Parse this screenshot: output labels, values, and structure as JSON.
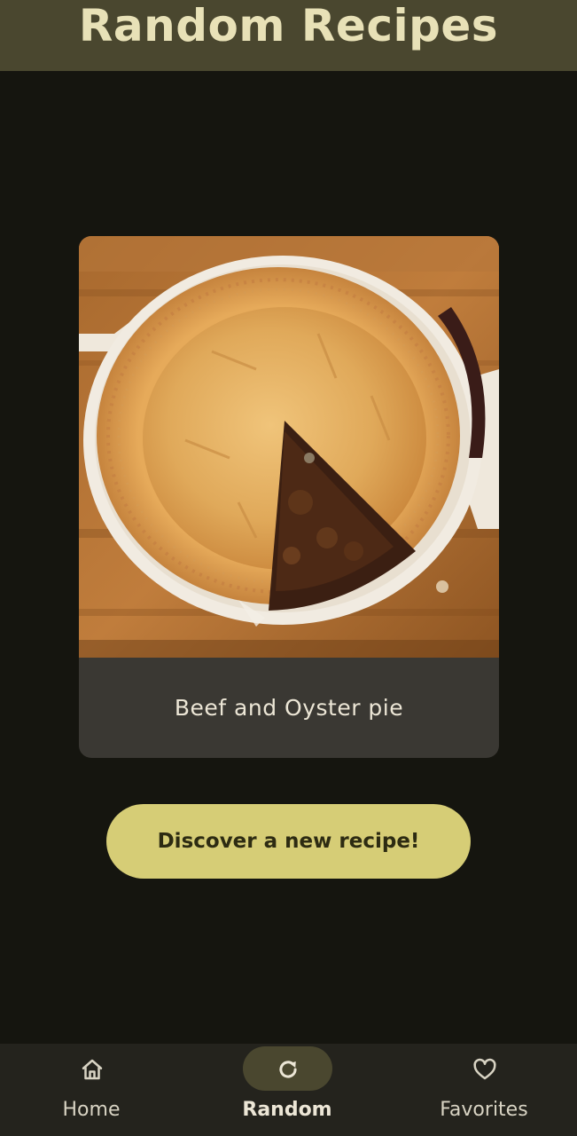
{
  "header": {
    "title": "Random Recipes"
  },
  "recipe": {
    "name": "Beef and Oyster pie",
    "image_icon": "beef-and-oyster-pie-photo"
  },
  "actions": {
    "discover_label": "Discover a new recipe!"
  },
  "bottom_nav": {
    "items": [
      {
        "label": "Home",
        "icon": "home-icon",
        "selected": false
      },
      {
        "label": "Random",
        "icon": "refresh-icon",
        "selected": true
      },
      {
        "label": "Favorites",
        "icon": "heart-icon",
        "selected": false
      }
    ]
  },
  "colors": {
    "background": "#15150f",
    "app_bar": "#4a472f",
    "title_text": "#e8e1b7",
    "card": "#3a3833",
    "button": "#d6cd76",
    "button_text": "#2d2b12",
    "nav_bar": "#24231d",
    "nav_indicator": "#4a472f"
  }
}
